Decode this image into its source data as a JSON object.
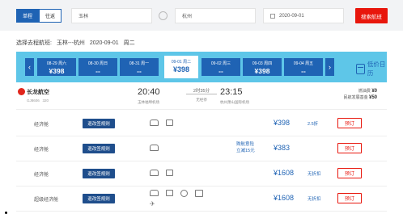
{
  "search": {
    "tab_oneway": "单程",
    "tab_roundtrip": "往返",
    "from": "玉林",
    "to": "杭州",
    "date": "2020-09-01",
    "search_button": "搜索航班"
  },
  "route": {
    "label": "选择去程航班:",
    "path": "玉林---杭州",
    "date": "2020-09-01",
    "weekday": "周二"
  },
  "date_strip": {
    "cells": [
      {
        "date": "08-29 周六",
        "price": "¥398"
      },
      {
        "date": "08-30 周日",
        "price": "--"
      },
      {
        "date": "08-31 周一",
        "price": "--"
      },
      {
        "date": "09-01 周二",
        "price": "¥398",
        "active": true
      },
      {
        "date": "09-02 周三",
        "price": "--"
      },
      {
        "date": "09-03 周四",
        "price": "¥398"
      },
      {
        "date": "09-04 周五",
        "price": "--"
      }
    ],
    "low_price_calendar": "低价日历",
    "prev_icon": "chevron-left-icon",
    "next_icon": "chevron-right-icon"
  },
  "flight": {
    "airline": "长龙航空",
    "flight_no": "GJ8606",
    "aircraft": "320",
    "dep_time": "20:40",
    "dep_airport": "玉林福绵机场",
    "duration": "2时35分",
    "stop": "无经停",
    "arr_time": "23:15",
    "arr_airport": "杭州萧山国际机场",
    "fee1_label": "燃油费",
    "fee1_value": "¥0",
    "fee2_label": "民航发展基金",
    "fee2_value": "¥50"
  },
  "fares": [
    {
      "cabin": "经济舱",
      "rule": "退改签规则",
      "promo1": "",
      "promo2": "",
      "price": "¥398",
      "discount": "2.5折",
      "book": "预订"
    },
    {
      "cabin": "经济舱",
      "rule": "退改签规则",
      "promo1": "购航意险",
      "promo2": "立减15元",
      "price": "¥383",
      "discount": "",
      "book": "预订"
    },
    {
      "cabin": "经济舱",
      "rule": "退改签规则",
      "promo1": "",
      "promo2": "",
      "price": "¥1608",
      "discount": "无折扣",
      "book": "预订"
    },
    {
      "cabin": "超级经济舱",
      "rule": "退改签规则",
      "promo1": "",
      "promo2": "",
      "price": "¥1608",
      "discount": "无折扣",
      "book": "预订"
    }
  ],
  "colors": {
    "brand_blue": "#1f63b4",
    "strip_bg": "#5ec6e8",
    "accent_red": "#e8160c"
  }
}
